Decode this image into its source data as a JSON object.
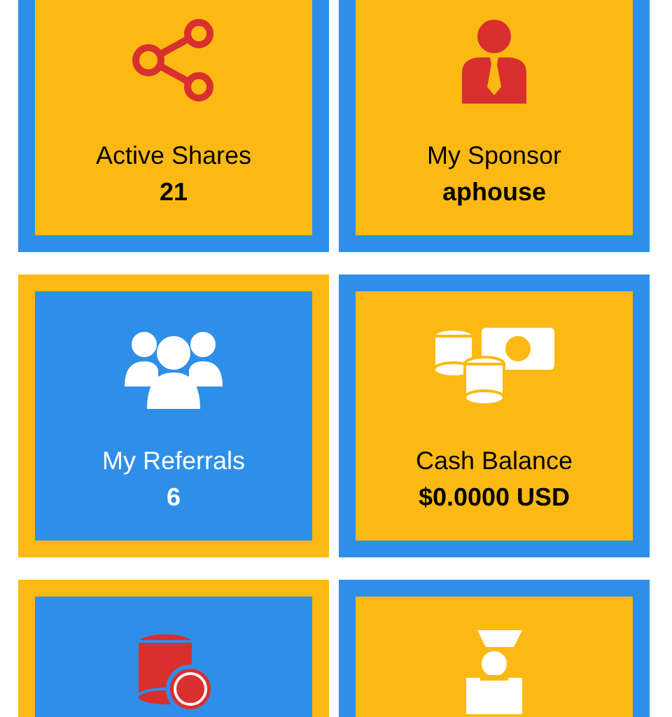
{
  "cards": [
    {
      "kind": "share",
      "color": "#fdb913",
      "label": "Active Shares",
      "value": "21"
    },
    {
      "kind": "sponsor",
      "color": "#fdb913",
      "label": "My Sponsor",
      "value": "aphouse"
    },
    {
      "kind": "referrals",
      "color": "#2e8fe8",
      "label": "My Referrals",
      "value": "6"
    },
    {
      "kind": "cash",
      "color": "#fdb913",
      "label": "Cash Balance",
      "value": "$0.0000 USD"
    },
    {
      "kind": "coins",
      "color": "#2e8fe8"
    },
    {
      "kind": "deposit",
      "color": "#fdb913"
    }
  ]
}
